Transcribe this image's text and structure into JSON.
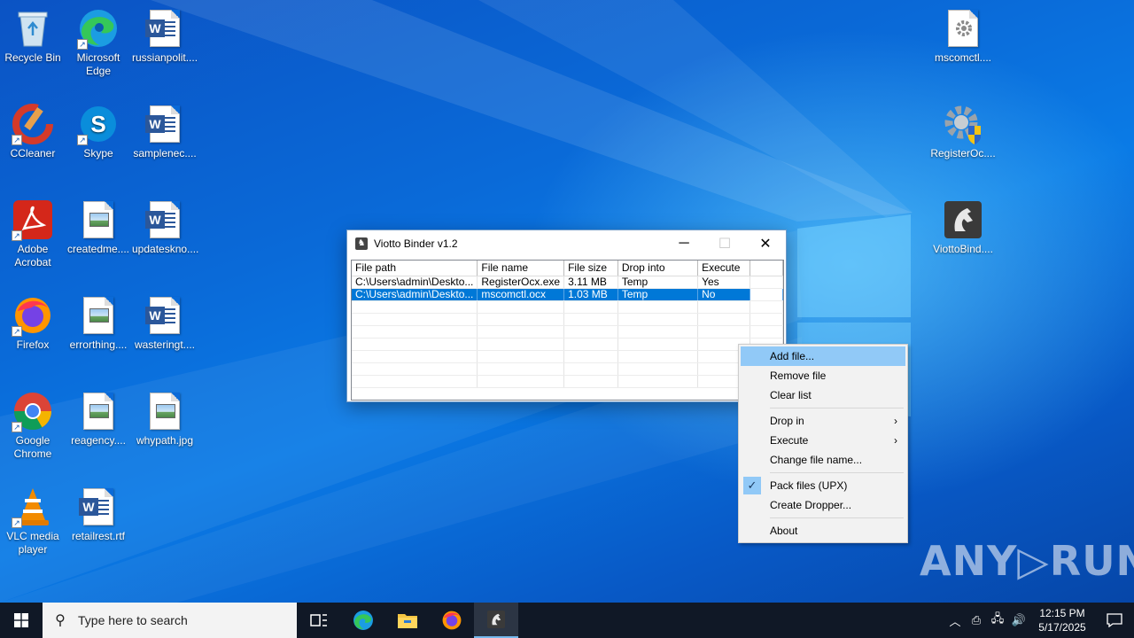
{
  "desktop": {
    "icons": [
      {
        "label": "Recycle Bin",
        "icon": "recycle-bin-icon"
      },
      {
        "label": "Microsoft Edge",
        "icon": "edge-icon"
      },
      {
        "label": "russianpolit....",
        "icon": "word-doc-icon"
      },
      {
        "label": "CCleaner",
        "icon": "ccleaner-icon"
      },
      {
        "label": "Skype",
        "icon": "skype-icon"
      },
      {
        "label": "samplenec....",
        "icon": "word-doc-icon"
      },
      {
        "label": "Adobe Acrobat",
        "icon": "acrobat-icon"
      },
      {
        "label": "createdme....",
        "icon": "image-file-icon"
      },
      {
        "label": "updateskno....",
        "icon": "word-doc-icon"
      },
      {
        "label": "Firefox",
        "icon": "firefox-icon"
      },
      {
        "label": "errorthing....",
        "icon": "image-file-icon"
      },
      {
        "label": "wasteringt....",
        "icon": "word-doc-icon"
      },
      {
        "label": "Google Chrome",
        "icon": "chrome-icon"
      },
      {
        "label": "reagency....",
        "icon": "image-file-icon"
      },
      {
        "label": "whypath.jpg",
        "icon": "image-file-icon"
      },
      {
        "label": "VLC media player",
        "icon": "vlc-icon"
      },
      {
        "label": "retailrest.rtf",
        "icon": "word-doc-icon"
      },
      {
        "label": "mscomctl....",
        "icon": "settings-file-icon"
      },
      {
        "label": "RegisterOc....",
        "icon": "gear-shield-icon"
      },
      {
        "label": "ViottoBind....",
        "icon": "viotto-binder-icon"
      }
    ]
  },
  "window": {
    "title": "Viotto Binder v1.2",
    "minimize": "─",
    "maximize": "☐",
    "close": "✕",
    "columns": [
      "File path",
      "File name",
      "File size",
      "Drop into",
      "Execute"
    ],
    "rows": [
      {
        "path": "C:\\Users\\admin\\Deskto...",
        "name": "RegisterOcx.exe",
        "size": "3.11 MB",
        "drop": "Temp",
        "execute": "Yes",
        "selected": false
      },
      {
        "path": "C:\\Users\\admin\\Deskto...",
        "name": "mscomctl.ocx",
        "size": "1.03 MB",
        "drop": "Temp",
        "execute": "No",
        "selected": true
      }
    ]
  },
  "context_menu": {
    "add_file": "Add file...",
    "remove_file": "Remove file",
    "clear_list": "Clear list",
    "drop_in": "Drop in",
    "execute": "Execute",
    "change_file_name": "Change file name...",
    "pack_files": "Pack files (UPX)",
    "pack_files_checked": true,
    "create_dropper": "Create Dropper...",
    "about": "About"
  },
  "watermark": "ANY▷RUN",
  "taskbar": {
    "search_placeholder": "Type here to search",
    "time": "12:15 PM",
    "date": "5/17/2025"
  },
  "colors": {
    "selection": "#0078d7",
    "menu_hover": "#91c9f7",
    "taskbar": "#101826"
  }
}
